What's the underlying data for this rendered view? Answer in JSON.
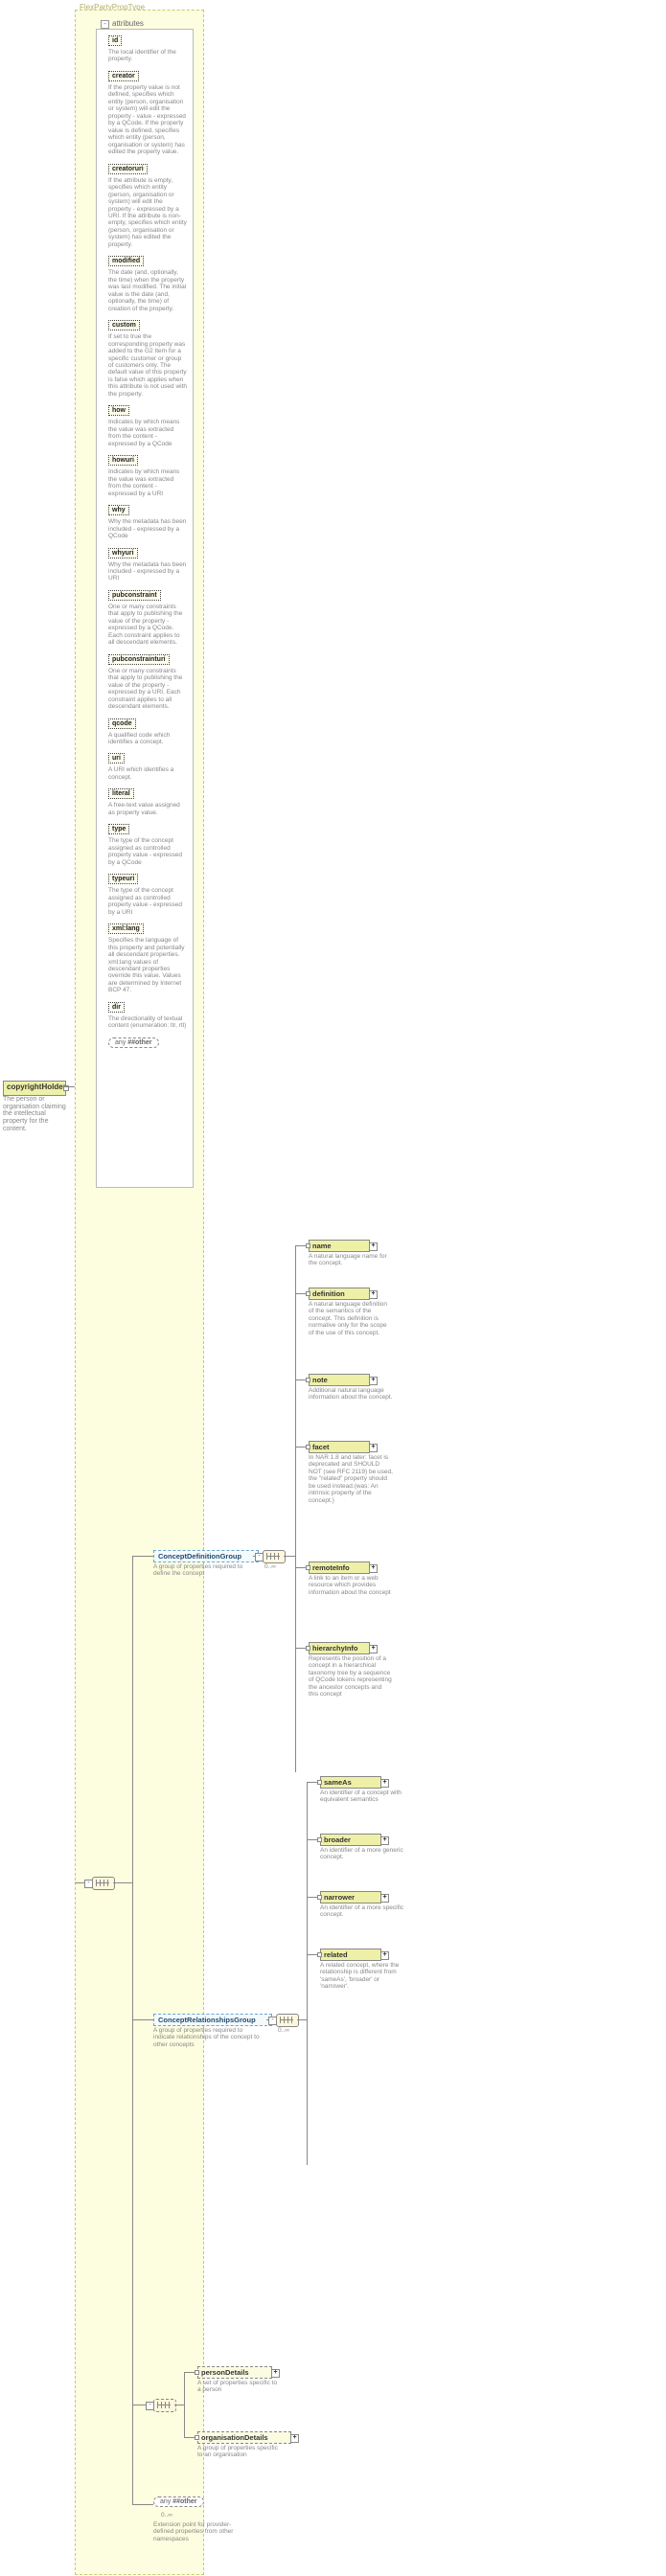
{
  "root": {
    "name": "copyrightHolder",
    "desc": "The person or organisation claiming the intellectual property for the content."
  },
  "typeName": "FlexPartyPropType",
  "attrHeader": "attributes",
  "attrs": [
    {
      "n": "id",
      "d": "The local identifier of the property."
    },
    {
      "n": "creator",
      "d": "If the property value is not defined, specifies which entity (person, organisation or system) will edit the property - value - expressed by a QCode. If the property value is defined, specifies which entity (person, organisation or system) has edited the property value."
    },
    {
      "n": "creatoruri",
      "d": "If the attribute is empty, specifies which entity (person, organisation or system) will edit the property - expressed by a URI. If the attribute is non-empty, specifies which entity (person, organisation or system) has edited the property."
    },
    {
      "n": "modified",
      "d": "The date (and, optionally, the time) when the property was last modified. The initial value is the date (and, optionally, the time) of creation of the property."
    },
    {
      "n": "custom",
      "d": "If set to true the corresponding property was added to the G2 Item for a specific customer or group of customers only. The default value of this property is false which applies when this attribute is not used with the property."
    },
    {
      "n": "how",
      "d": "Indicates by which means the value was extracted from the content - expressed by a QCode"
    },
    {
      "n": "howuri",
      "d": "Indicates by which means the value was extracted from the content - expressed by a URI"
    },
    {
      "n": "why",
      "d": "Why the metadata has been included - expressed by a QCode"
    },
    {
      "n": "whyuri",
      "d": "Why the metadata has been included - expressed by a URI"
    },
    {
      "n": "pubconstraint",
      "d": "One or many constraints that apply to publishing the value of the property - expressed by a QCode. Each constraint applies to all descendant elements."
    },
    {
      "n": "pubconstrainturi",
      "d": "One or many constraints that apply to publishing the value of the property - expressed by a URI. Each constraint applies to all descendant elements."
    },
    {
      "n": "qcode",
      "d": "A qualified code which identifies a concept."
    },
    {
      "n": "uri",
      "d": "A URI which identifies a concept."
    },
    {
      "n": "literal",
      "d": "A free-text value assigned as property value."
    },
    {
      "n": "type",
      "d": "The type of the concept assigned as controlled property value - expressed by a QCode"
    },
    {
      "n": "typeuri",
      "d": "The type of the concept assigned as controlled property value - expressed by a URI"
    },
    {
      "n": "xml:lang",
      "d": "Specifies the language of this property and potentially all descendant properties. xml:lang values of descendant properties override this value. Values are determined by Internet BCP 47."
    },
    {
      "n": "dir",
      "d": "The directionality of textual content (enumeration: ltr, rtl)"
    }
  ],
  "attrAny": "##other",
  "anyLabelPrefix": "any ",
  "mainOccur": "0..∞",
  "g1": {
    "name": "ConceptDefinitionGroup",
    "desc": "A group of properties required to define the concept"
  },
  "g1occ": "0..∞",
  "g1items": [
    {
      "n": "name",
      "d": "A natural language name for the concept."
    },
    {
      "n": "definition",
      "d": "A natural language definition of the semantics of the concept. This definition is normative only for the scope of the use of this concept."
    },
    {
      "n": "note",
      "d": "Additional natural language information about the concept."
    },
    {
      "n": "facet",
      "d": "In NAR 1.8 and later: facet is deprecated and SHOULD NOT (see RFC 2119) be used, the \"related\" property should be used instead.(was: An intrinsic property of the concept.)"
    },
    {
      "n": "remoteInfo",
      "d": "A link to an item or a web resource which provides information about the concept"
    },
    {
      "n": "hierarchyInfo",
      "d": "Represents the position of a concept in a hierarchical taxonomy tree by a sequence of QCode tokens representing the ancestor concepts and this concept"
    }
  ],
  "g2": {
    "name": "ConceptRelationshipsGroup",
    "desc": "A group of properties required to indicate relationships of the concept to other concepts"
  },
  "g2occ": "0..∞",
  "g2items": [
    {
      "n": "sameAs",
      "d": "An identifier of a concept with equivalent semantics"
    },
    {
      "n": "broader",
      "d": "An identifier of a more generic concept."
    },
    {
      "n": "narrower",
      "d": "An identifier of a more specific concept."
    },
    {
      "n": "related",
      "d": "A related concept, where the relationship is different from 'sameAs', 'broader' or 'narrower'."
    }
  ],
  "g3items": [
    {
      "n": "personDetails",
      "d": "A set of properties specific to a person"
    },
    {
      "n": "organisationDetails",
      "d": "A group of properties specific to an organisation"
    }
  ],
  "tailAny": "##other",
  "tailOcc": "0..∞",
  "tailDesc": "Extension point for provider-defined properties from other namespaces"
}
